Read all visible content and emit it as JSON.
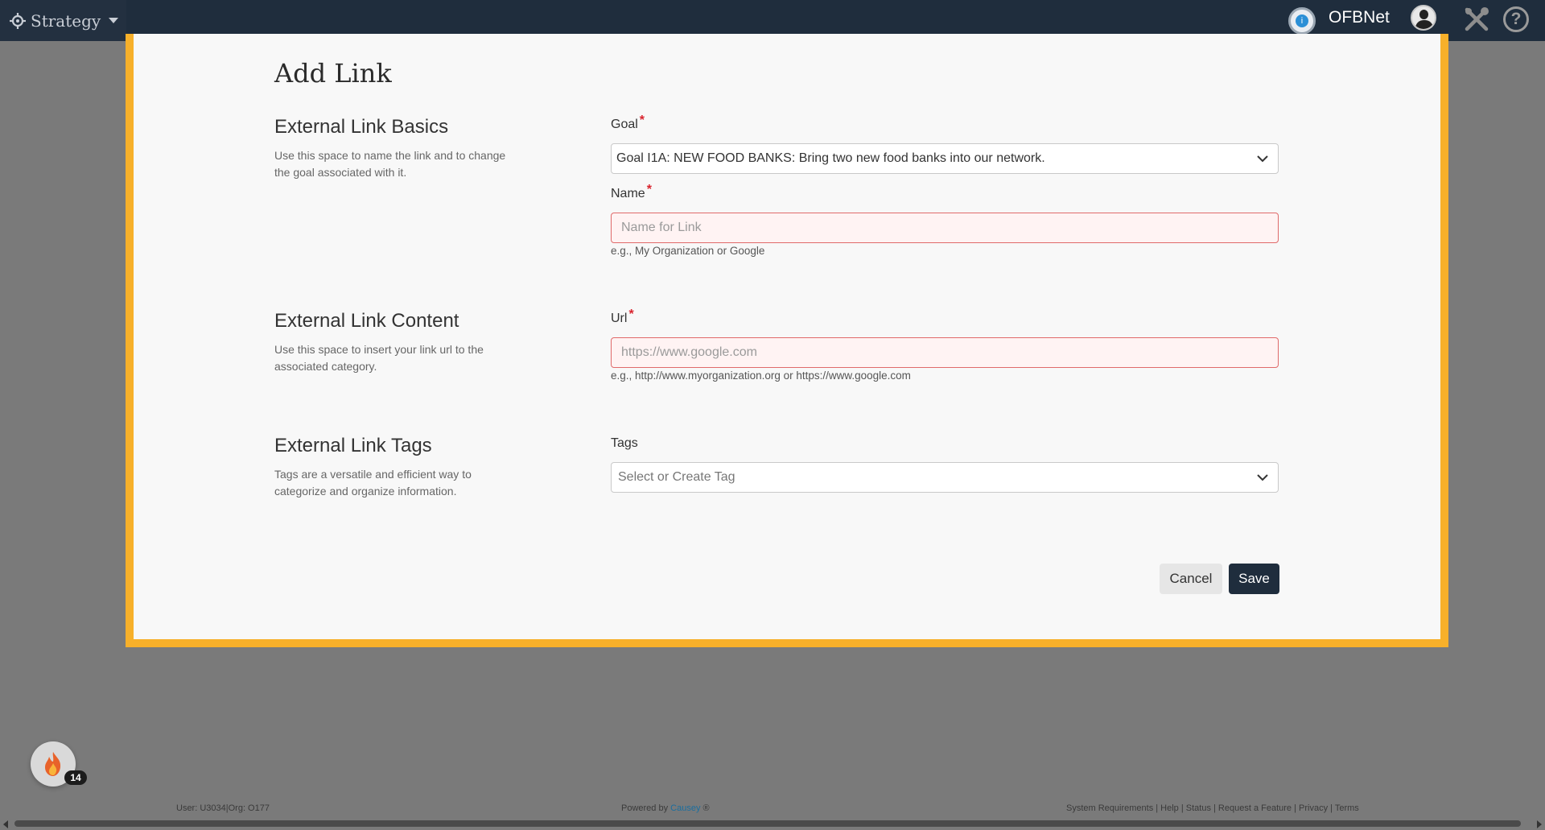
{
  "topbar": {
    "app_name": "Strategy",
    "org_name": "OFBNet"
  },
  "modal": {
    "title": "Add Link",
    "sections": {
      "basics": {
        "title": "External Link Basics",
        "description": "Use this space to name the link and to change the goal associated with it."
      },
      "content": {
        "title": "External Link Content",
        "description": "Use this space to insert your link url to the associated category."
      },
      "tags": {
        "title": "External Link Tags",
        "description": "Tags are a versatile and efficient way to categorize and organize information."
      }
    },
    "fields": {
      "goal": {
        "label": "Goal",
        "required_mark": "*",
        "value": "Goal I1A: NEW FOOD BANKS: Bring two new food banks into our network."
      },
      "name": {
        "label": "Name",
        "required_mark": "*",
        "value": "",
        "placeholder": "Name for Link",
        "help": "e.g., My Organization or Google"
      },
      "url": {
        "label": "Url",
        "required_mark": "*",
        "value": "",
        "placeholder": "https://www.google.com",
        "help": "e.g., http://www.myorganization.org or https://www.google.com"
      },
      "tags": {
        "label": "Tags",
        "placeholder": "Select or Create Tag"
      }
    },
    "buttons": {
      "cancel": "Cancel",
      "save": "Save"
    }
  },
  "notifications": {
    "count": "14"
  },
  "footer": {
    "user_info": "User: U3034|Org: O177",
    "powered_by": "Powered by",
    "powered_brand": "Causey",
    "powered_mark": "®",
    "links": "System Requirements | Help | Status | Request a Feature | Privacy | Terms"
  },
  "colors": {
    "topbar_bg": "#1f2d3d",
    "modal_border": "#f7b02a",
    "required": "#d9232d",
    "error_border": "#e06a6a",
    "error_bg": "#fff3f3",
    "primary_button": "#1f2d3d"
  },
  "icons": {
    "brand": "crosshair-gear-icon",
    "org_logo": "org-logo-icon",
    "avatar": "user-avatar-icon",
    "tools": "wrench-screwdriver-icon",
    "help": "question-circle-icon",
    "select_chevron": "chevron-down-icon",
    "notifications": "flame-icon"
  }
}
